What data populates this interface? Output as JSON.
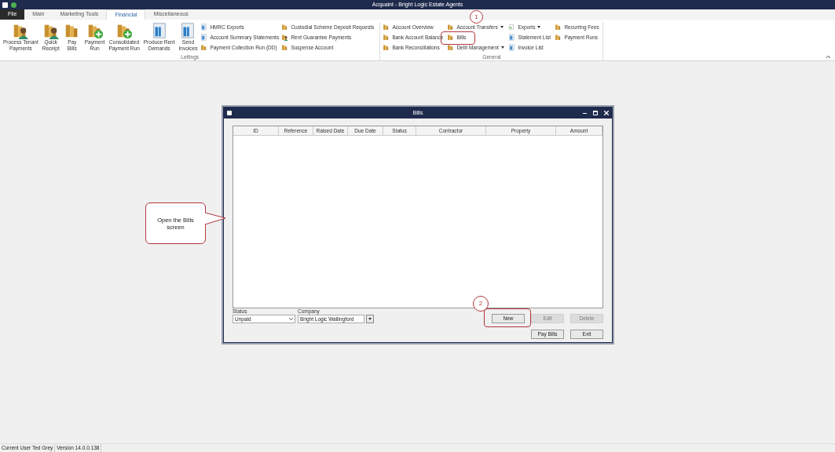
{
  "window": {
    "title": "Acquaint - Bright Logic Estate Agents"
  },
  "tabs": [
    {
      "label": "File",
      "kind": "file",
      "selected": false
    },
    {
      "label": "Main",
      "kind": "tab",
      "selected": false
    },
    {
      "label": "Marketing Tools",
      "kind": "tab",
      "selected": false
    },
    {
      "label": "Financial",
      "kind": "tab",
      "selected": true
    },
    {
      "label": "Miscellaneous",
      "kind": "tab",
      "selected": false
    }
  ],
  "ribbon": {
    "groups": [
      {
        "label": "Lettings",
        "large_buttons": [
          {
            "lines": [
              "Process Tenant",
              "Payments"
            ],
            "kind": "person"
          },
          {
            "lines": [
              "Quick",
              "Receipt"
            ],
            "kind": "person"
          },
          {
            "lines": [
              "Pay",
              "Bills"
            ],
            "kind": "gold"
          },
          {
            "lines": [
              "Payment",
              "Run"
            ],
            "kind": "plus"
          },
          {
            "lines": [
              "Consolidated",
              "Payment Run"
            ],
            "kind": "plus"
          },
          {
            "lines": [
              "Produce Rent",
              "Demands"
            ],
            "kind": "doc"
          },
          {
            "lines": [
              "Send",
              "Invoices"
            ],
            "kind": "doc"
          }
        ],
        "columns": [
          [
            {
              "label": "HMRC Exports",
              "kind": "doc",
              "dropdown": false
            },
            {
              "label": "Account Summary Statements",
              "kind": "doc",
              "dropdown": false
            },
            {
              "label": "Payment Collection Run (DD)",
              "kind": "gold",
              "dropdown": false
            }
          ],
          [
            {
              "label": "Custodial Scheme Deposit Requests",
              "kind": "gold",
              "dropdown": false
            },
            {
              "label": "Rent Guarantee Payments",
              "kind": "person",
              "dropdown": false
            },
            {
              "label": "Suspense Account",
              "kind": "gold",
              "dropdown": false
            }
          ]
        ]
      },
      {
        "label": "General",
        "columns": [
          [
            {
              "label": "Account Overview",
              "kind": "gold",
              "dropdown": false
            },
            {
              "label": "Bank Account Balance",
              "kind": "gold",
              "dropdown": false
            },
            {
              "label": "Bank Reconciliations",
              "kind": "gold",
              "dropdown": false
            }
          ],
          [
            {
              "label": "Account Transfers",
              "kind": "gold",
              "dropdown": true
            },
            {
              "label": "Bills",
              "kind": "gold",
              "dropdown": false
            },
            {
              "label": "Debt Management",
              "kind": "gold",
              "dropdown": true
            }
          ],
          [
            {
              "label": "Exports",
              "kind": "export",
              "dropdown": true
            },
            {
              "label": "Statement List",
              "kind": "doc",
              "dropdown": false
            },
            {
              "label": "Invoice List",
              "kind": "doc",
              "dropdown": false
            }
          ],
          [
            {
              "label": "Recurring Fees",
              "kind": "gold",
              "dropdown": false
            },
            {
              "label": "Payment Runs",
              "kind": "gold",
              "dropdown": false
            }
          ]
        ]
      }
    ]
  },
  "dialog": {
    "title": "Bills",
    "columns": [
      "ID",
      "Reference",
      "Raised Date",
      "Due Date",
      "Status",
      "Contractor",
      "Property",
      "Amount"
    ],
    "status_filter": {
      "label": "Status",
      "value": "Unpaid"
    },
    "company_filter": {
      "label": "Company",
      "value": "Bright Logic Wallingford"
    },
    "buttons": [
      {
        "label": "New",
        "disabled": false
      },
      {
        "label": "Edit",
        "disabled": true
      },
      {
        "label": "Delete",
        "disabled": true
      }
    ],
    "bottom_buttons": [
      {
        "label": "Pay Bills",
        "disabled": false
      },
      {
        "label": "Exit",
        "disabled": false
      }
    ]
  },
  "annotations": {
    "step_1": "1",
    "step_2": "2",
    "callout": "Open the Bills screen"
  },
  "status_bar": [
    "Current User Ted Grey",
    "Version 14.0.0.138"
  ]
}
